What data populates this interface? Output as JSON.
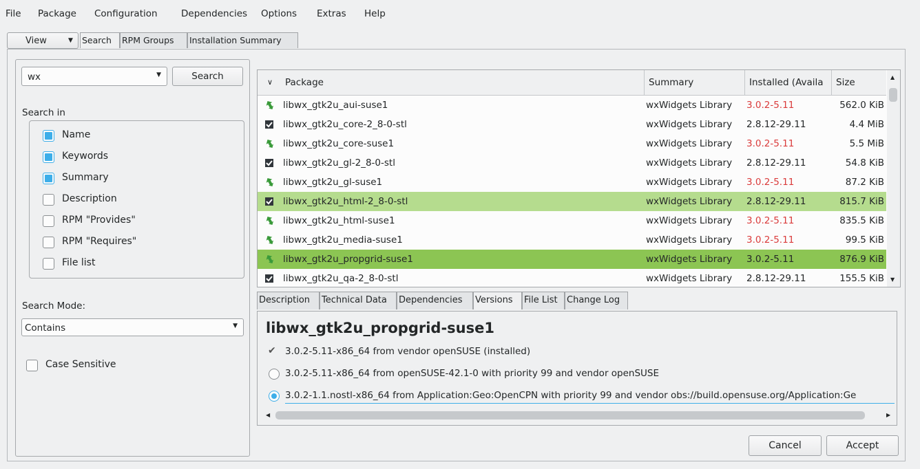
{
  "menu": [
    "File",
    "Package",
    "Configuration",
    "Dependencies",
    "Options",
    "Extras",
    "Help"
  ],
  "top_tabs": {
    "view_label": "View",
    "items": [
      "Search",
      "RPM Groups",
      "Installation Summary"
    ]
  },
  "search": {
    "query": "wx",
    "button": "Search",
    "search_in_label": "Search in",
    "options": [
      {
        "label": "Name",
        "checked": true
      },
      {
        "label": "Keywords",
        "checked": true
      },
      {
        "label": "Summary",
        "checked": true
      },
      {
        "label": "Description",
        "checked": false
      },
      {
        "label": "RPM \"Provides\"",
        "checked": false
      },
      {
        "label": "RPM \"Requires\"",
        "checked": false
      },
      {
        "label": "File list",
        "checked": false
      }
    ],
    "mode_label": "Search Mode:",
    "mode_value": "Contains",
    "case_label": "Case Sensitive"
  },
  "table": {
    "headers": [
      "Package",
      "Summary",
      "Installed (Availa",
      "Size"
    ],
    "rows": [
      {
        "icon": "update-icon",
        "name": "libwx_gtk2u_aui-suse1",
        "summary": "wxWidgets Library",
        "version": "3.0.2-5.11",
        "version_red": true,
        "size": "562.0 KiB"
      },
      {
        "icon": "installed-icon",
        "name": "libwx_gtk2u_core-2_8-0-stl",
        "summary": "wxWidgets Library",
        "version": "2.8.12-29.11",
        "version_red": false,
        "size": "4.4 MiB"
      },
      {
        "icon": "update-icon",
        "name": "libwx_gtk2u_core-suse1",
        "summary": "wxWidgets Library",
        "version": "3.0.2-5.11",
        "version_red": true,
        "size": "5.5 MiB"
      },
      {
        "icon": "installed-icon",
        "name": "libwx_gtk2u_gl-2_8-0-stl",
        "summary": "wxWidgets Library",
        "version": "2.8.12-29.11",
        "version_red": false,
        "size": "54.8 KiB"
      },
      {
        "icon": "update-icon",
        "name": "libwx_gtk2u_gl-suse1",
        "summary": "wxWidgets Library",
        "version": "3.0.2-5.11",
        "version_red": true,
        "size": "87.2 KiB"
      },
      {
        "icon": "installed-icon",
        "name": "libwx_gtk2u_html-2_8-0-stl",
        "summary": "wxWidgets Library",
        "version": "2.8.12-29.11",
        "version_red": false,
        "size": "815.7 KiB",
        "highlight": "light"
      },
      {
        "icon": "update-icon",
        "name": "libwx_gtk2u_html-suse1",
        "summary": "wxWidgets Library",
        "version": "3.0.2-5.11",
        "version_red": true,
        "size": "835.5 KiB"
      },
      {
        "icon": "update-icon",
        "name": "libwx_gtk2u_media-suse1",
        "summary": "wxWidgets Library",
        "version": "3.0.2-5.11",
        "version_red": true,
        "size": "99.5 KiB"
      },
      {
        "icon": "update-icon",
        "name": "libwx_gtk2u_propgrid-suse1",
        "summary": "wxWidgets Library",
        "version": "3.0.2-5.11",
        "version_red": false,
        "size": "876.9 KiB",
        "highlight": "dark"
      },
      {
        "icon": "installed-icon",
        "name": "libwx_gtk2u_qa-2_8-0-stl",
        "summary": "wxWidgets Library",
        "version": "2.8.12-29.11",
        "version_red": false,
        "size": "155.5 KiB"
      }
    ]
  },
  "detail_tabs": [
    "Description",
    "Technical Data",
    "Dependencies",
    "Versions",
    "File List",
    "Change Log"
  ],
  "detail": {
    "title": "libwx_gtk2u_propgrid-suse1",
    "versions": [
      {
        "type": "check",
        "text": "3.0.2-5.11-x86_64 from vendor openSUSE (installed)"
      },
      {
        "type": "radio",
        "selected": false,
        "text": "3.0.2-5.11-x86_64 from openSUSE-42.1-0 with priority 99 and vendor openSUSE"
      },
      {
        "type": "radio",
        "selected": true,
        "text": "3.0.2-1.1.nostl-x86_64 from Application:Geo:OpenCPN with priority 99 and vendor obs://build.opensuse.org/Application:Ge"
      }
    ]
  },
  "buttons": {
    "cancel": "Cancel",
    "accept": "Accept"
  },
  "colors": {
    "accent": "#3daee9",
    "selection_light": "#b5dc8e",
    "selection_dark": "#8cc553",
    "version_red": "#da3b3b"
  }
}
